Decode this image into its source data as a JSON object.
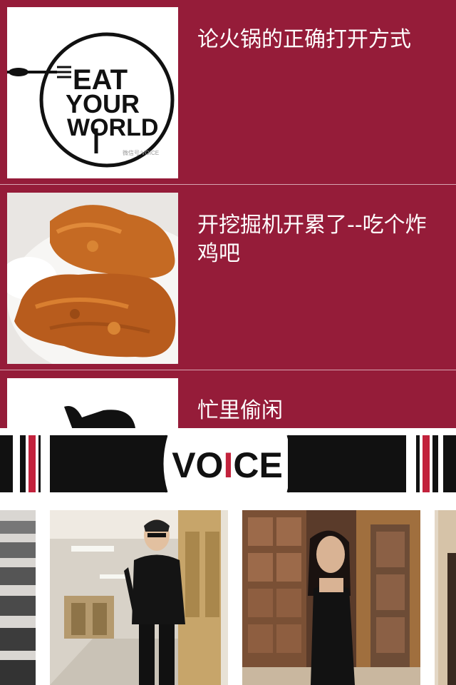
{
  "articles": [
    {
      "title": "论火锅的正确打开方式",
      "thumb": "eat-your-world-logo",
      "logo_text": [
        "EAT",
        "YOUR",
        "WORLD"
      ],
      "watermark": "微信号:VOICE"
    },
    {
      "title": "开挖掘机开累了--吃个炸鸡吧",
      "thumb": "fried-chicken-photo"
    },
    {
      "title": "忙里偷闲",
      "thumb": "thumbs-up-drawing"
    }
  ],
  "banner": {
    "brand": "VOICE",
    "brand_parts": [
      "VO",
      "I",
      "CE"
    ],
    "accent_color": "#c2223c"
  },
  "gallery": {
    "photos": [
      {
        "subject": "lecture-hall"
      },
      {
        "subject": "man-in-leather-jacket"
      },
      {
        "subject": "woman-in-black-dress"
      },
      {
        "subject": "partial-photo"
      }
    ]
  },
  "colors": {
    "feed_background": "#951c39",
    "title_text": "#ffffff"
  }
}
